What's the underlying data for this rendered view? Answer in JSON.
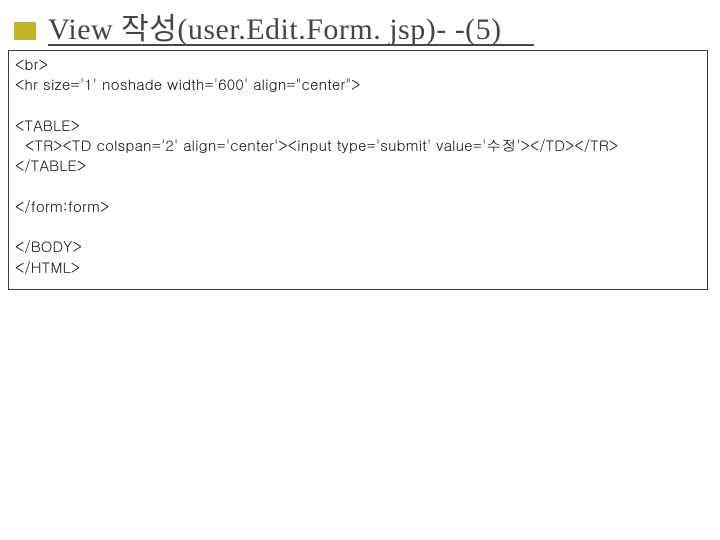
{
  "title": "View 작성(user.Edit.Form. jsp)- -(5)",
  "code": {
    "l1": "<br>",
    "l2": "<hr size='1' noshade width='600' align=\"center\">",
    "l3": "",
    "l4": "<TABLE>",
    "l5": "  <TR><TD colspan='2' align='center'><input type='submit' value='수정'></TD></TR>",
    "l6": "</TABLE>",
    "l7": "",
    "l8": "</form:form>",
    "l9": "",
    "l10": "</BODY>",
    "l11": "</HTML>"
  }
}
